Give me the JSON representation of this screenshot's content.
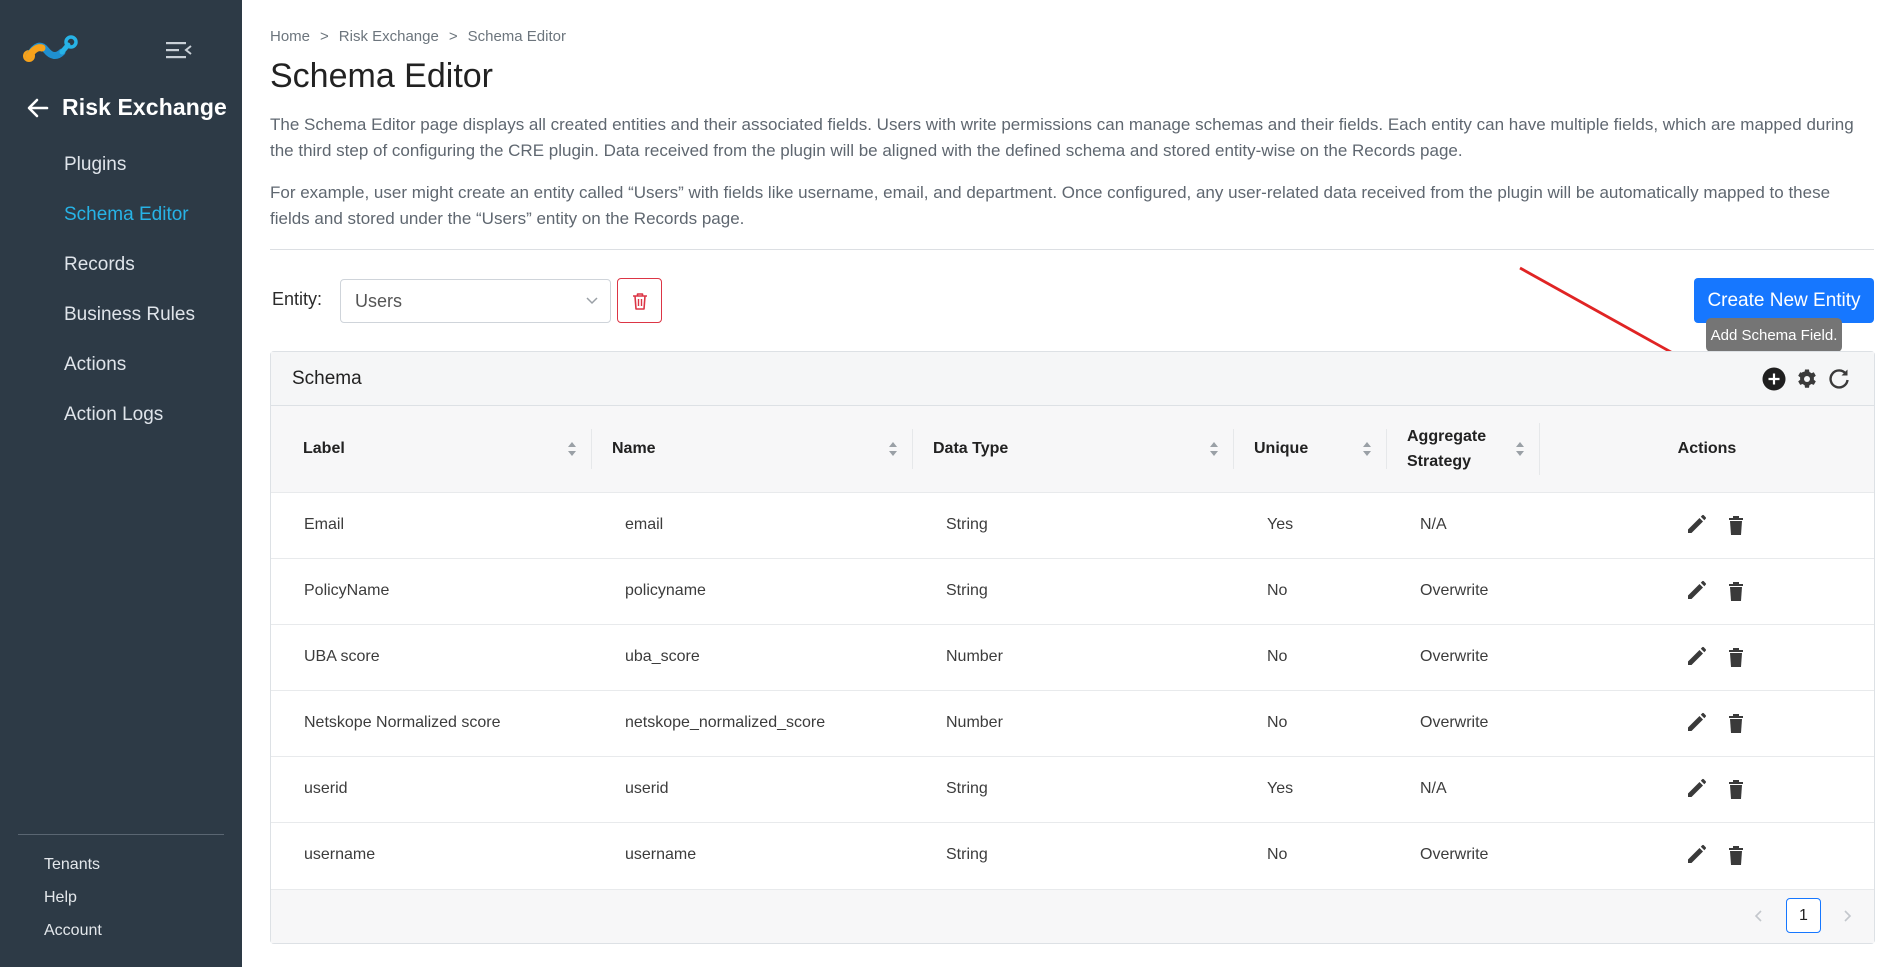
{
  "sidebar": {
    "section_title": "Risk Exchange",
    "items": [
      {
        "label": "Plugins",
        "active": false
      },
      {
        "label": "Schema Editor",
        "active": true
      },
      {
        "label": "Records",
        "active": false
      },
      {
        "label": "Business Rules",
        "active": false
      },
      {
        "label": "Actions",
        "active": false
      },
      {
        "label": "Action Logs",
        "active": false
      }
    ],
    "bottom_items": [
      {
        "label": "Tenants"
      },
      {
        "label": "Help"
      },
      {
        "label": "Account"
      }
    ]
  },
  "breadcrumb": [
    "Home",
    "Risk Exchange",
    "Schema Editor"
  ],
  "breadcrumb_separator": ">",
  "page_title": "Schema Editor",
  "description": [
    "The Schema Editor page displays all created entities and their associated fields. Users with write permissions can manage schemas and their fields. Each entity can have multiple fields, which are mapped during the third step of configuring the CRE plugin. Data received from the plugin will be aligned with the defined schema and stored entity-wise on the Records page.",
    "For example, user might create an entity called “Users” with fields like username, email, and department. Once configured, any user-related data received from the plugin will be automatically mapped to these fields and stored under the “Users” entity on the Records page."
  ],
  "entity": {
    "label": "Entity:",
    "selected": "Users"
  },
  "create_button": "Create New Entity",
  "tooltip": "Add Schema Field.",
  "schema": {
    "title": "Schema",
    "columns": [
      "Label",
      "Name",
      "Data Type",
      "Unique",
      "Aggregate Strategy",
      "Actions"
    ],
    "rows": [
      {
        "label": "Email",
        "name": "email",
        "data_type": "String",
        "unique": "Yes",
        "aggregate": "N/A"
      },
      {
        "label": "PolicyName",
        "name": "policyname",
        "data_type": "String",
        "unique": "No",
        "aggregate": "Overwrite"
      },
      {
        "label": "UBA score",
        "name": "uba_score",
        "data_type": "Number",
        "unique": "No",
        "aggregate": "Overwrite"
      },
      {
        "label": "Netskope Normalized score",
        "name": "netskope_normalized_score",
        "data_type": "Number",
        "unique": "No",
        "aggregate": "Overwrite"
      },
      {
        "label": "userid",
        "name": "userid",
        "data_type": "String",
        "unique": "Yes",
        "aggregate": "N/A"
      },
      {
        "label": "username",
        "name": "username",
        "data_type": "String",
        "unique": "No",
        "aggregate": "Overwrite"
      }
    ]
  },
  "pagination": {
    "current_page": "1"
  },
  "icons": {
    "logo": "netskope-logo",
    "menu_toggle": "menu-collapse-icon",
    "back": "arrow-left-icon",
    "delete_entity": "trash-outline-icon",
    "add_field": "plus-circle-icon",
    "settings": "gear-icon",
    "refresh": "refresh-icon",
    "edit": "pencil-icon",
    "delete": "trash-icon"
  },
  "colors": {
    "sidebar_bg": "#2d3a46",
    "active_nav": "#27b3e6",
    "primary": "#1677ff",
    "danger": "#dc3545",
    "annotation_arrow": "#e02424"
  }
}
